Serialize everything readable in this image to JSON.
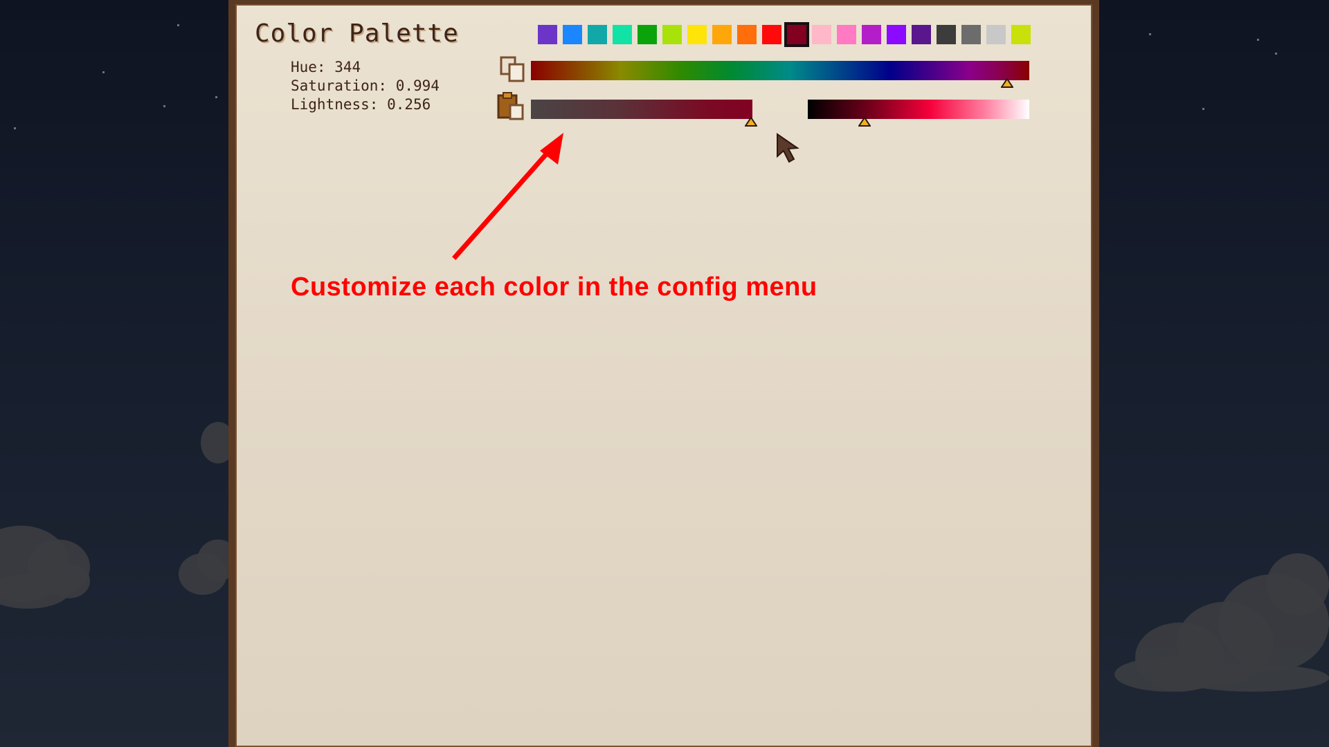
{
  "panel": {
    "title": "Color Palette"
  },
  "info": {
    "hue": "Hue: 344",
    "saturation": "Saturation: 0.994",
    "lightness": "Lightness: 0.256"
  },
  "palette": {
    "swatches": [
      "#6b35c8",
      "#1a86ff",
      "#13a8a8",
      "#11e3a6",
      "#0aa40a",
      "#a8e20a",
      "#ffe40a",
      "#ffa60a",
      "#ff6e0a",
      "#ff0a0a",
      "#820020",
      "#ffb8c8",
      "#ff7ac3",
      "#b41ec8",
      "#8c0aff",
      "#5a168c",
      "#3c3c3c",
      "#6c6c6c",
      "#c8c8c8",
      "#c8e10a"
    ],
    "selected_index": 10
  },
  "sliders": {
    "hue": 344,
    "saturation": 0.994,
    "lightness": 0.256
  },
  "icons": {
    "copy": "copy-icon",
    "paste": "paste-icon"
  },
  "annotation": {
    "text": "Customize each color in the config menu"
  },
  "colors": {
    "panel_border": "#5b3a24",
    "text": "#3d2418",
    "annotation": "#ff0000",
    "knob": "#f0b020"
  }
}
